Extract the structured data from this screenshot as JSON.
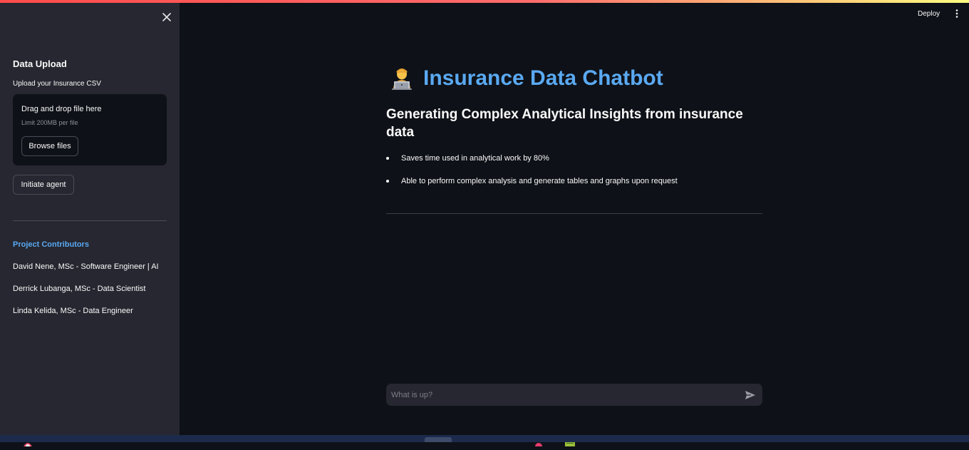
{
  "window": {
    "deploy_label": "Deploy"
  },
  "sidebar": {
    "heading": "Data Upload",
    "upload_label": "Upload your Insurance CSV",
    "dropzone": {
      "title": "Drag and drop file here",
      "limit": "Limit 200MB per file",
      "browse_label": "Browse files"
    },
    "initiate_label": "Initiate agent",
    "contributors_title": "Project Contributors",
    "contributors": [
      "David Nene, MSc - Software Engineer | AI",
      "Derrick Lubanga, MSc - Data Scientist",
      "Linda Kelida, MSc - Data Engineer"
    ]
  },
  "main": {
    "title": "Insurance Data Chatbot",
    "title_emoji": "technologist-icon",
    "subtitle": "Generating Complex Analytical Insights from insurance data",
    "bullets": [
      "Saves time used in analytical work by 80%",
      "Able to perform complex analysis and generate tables and graphs upon request"
    ]
  },
  "chat": {
    "placeholder": "What is up?"
  },
  "colors": {
    "background": "#0e1117",
    "sidebar": "#262730",
    "accent_blue": "#5aa9f2",
    "top_bar_start": "#ff4b4b",
    "top_bar_end": "#fffd80"
  }
}
